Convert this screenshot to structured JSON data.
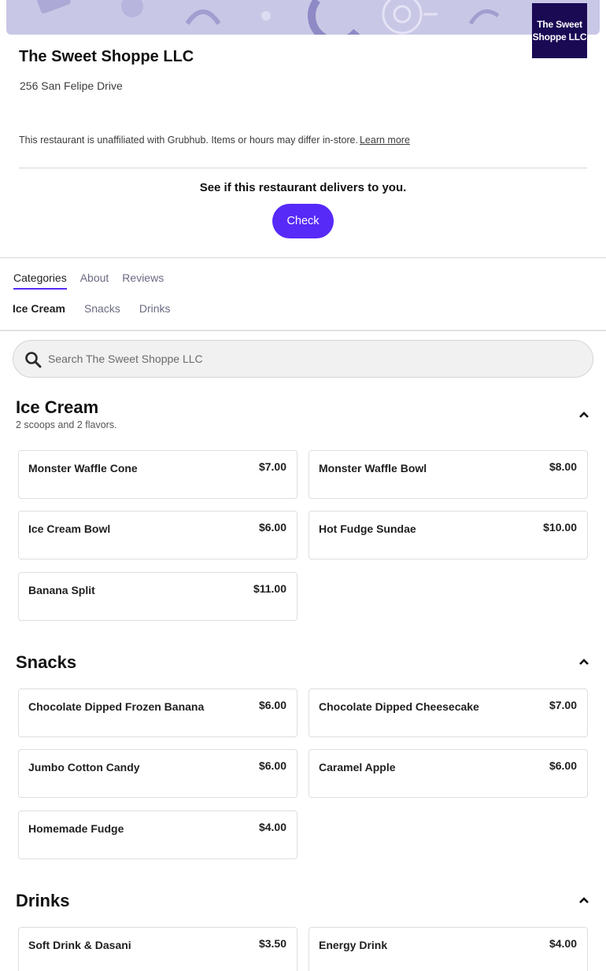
{
  "restaurant": {
    "name": "The Sweet Shoppe LLC",
    "logo_text": "The Sweet Shoppe LLC",
    "address": "256 San Felipe Drive",
    "disclaimer": "This restaurant is unaffiliated with Grubhub. Items or hours may differ in-store.",
    "learn_more": "Learn more"
  },
  "delivery": {
    "prompt": "See if this restaurant delivers to you.",
    "check_label": "Check"
  },
  "tabs": [
    "Categories",
    "About",
    "Reviews"
  ],
  "subnav": [
    "Ice Cream",
    "Snacks",
    "Drinks"
  ],
  "search": {
    "placeholder": "Search The Sweet Shoppe LLC"
  },
  "colors": {
    "accent": "#572af8",
    "logo_bg": "#1a0a54",
    "hero_bg": "#c9c7e6"
  },
  "sections": [
    {
      "title": "Ice Cream",
      "subtitle": "2 scoops and 2 flavors.",
      "items": [
        {
          "name": "Monster Waffle Cone",
          "price": "$7.00"
        },
        {
          "name": "Monster Waffle Bowl",
          "price": "$8.00"
        },
        {
          "name": "Ice Cream Bowl",
          "price": "$6.00"
        },
        {
          "name": "Hot Fudge Sundae",
          "price": "$10.00"
        },
        {
          "name": "Banana Split",
          "price": "$11.00"
        }
      ]
    },
    {
      "title": "Snacks",
      "items": [
        {
          "name": "Chocolate Dipped Frozen Banana",
          "price": "$6.00"
        },
        {
          "name": "Chocolate Dipped Cheesecake",
          "price": "$7.00"
        },
        {
          "name": "Jumbo Cotton Candy",
          "price": "$6.00"
        },
        {
          "name": "Caramel Apple",
          "price": "$6.00"
        },
        {
          "name": "Homemade Fudge",
          "price": "$4.00"
        }
      ]
    },
    {
      "title": "Drinks",
      "items": [
        {
          "name": "Soft Drink & Dasani",
          "price": "$3.50"
        },
        {
          "name": "Energy Drink",
          "price": "$4.00"
        }
      ]
    }
  ]
}
